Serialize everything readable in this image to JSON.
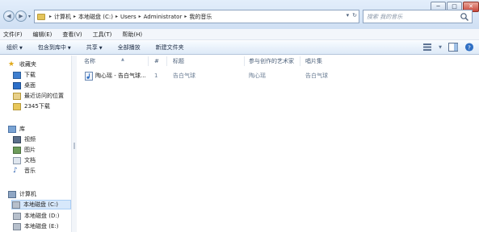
{
  "address": {
    "crumbs": [
      "计算机",
      "本地磁盘 (C:)",
      "Users",
      "Administrator",
      "我的音乐"
    ]
  },
  "search": {
    "placeholder": "搜索 我的音乐"
  },
  "menu": {
    "items": [
      "文件(F)",
      "编辑(E)",
      "查看(V)",
      "工具(T)",
      "帮助(H)"
    ]
  },
  "toolbar": {
    "organize": "组织",
    "include_in_library": "包含到库中",
    "share": "共享",
    "play_all": "全部播放",
    "new_folder": "新建文件夹"
  },
  "nav": {
    "favorites": "收藏夹",
    "downloads": "下载",
    "desktop": "桌面",
    "recent_places": "最近访问的位置",
    "downloads_2345": "2345下载",
    "libraries": "库",
    "videos": "视频",
    "pictures": "图片",
    "documents": "文档",
    "music": "音乐",
    "computer": "计算机",
    "drive_c": "本地磁盘 (C:)",
    "drive_d": "本地磁盘 (D:)",
    "drive_e": "本地磁盘 (E:)"
  },
  "columns": {
    "name": "名称",
    "number": "#",
    "title": "标题",
    "artists": "参与创作的艺术家",
    "album": "唱片集"
  },
  "files": [
    {
      "name": "陶心瑶 - 告白气球...",
      "number": "1",
      "title": "告白气球",
      "artist": "陶心瑶",
      "album": "告白气球"
    }
  ]
}
